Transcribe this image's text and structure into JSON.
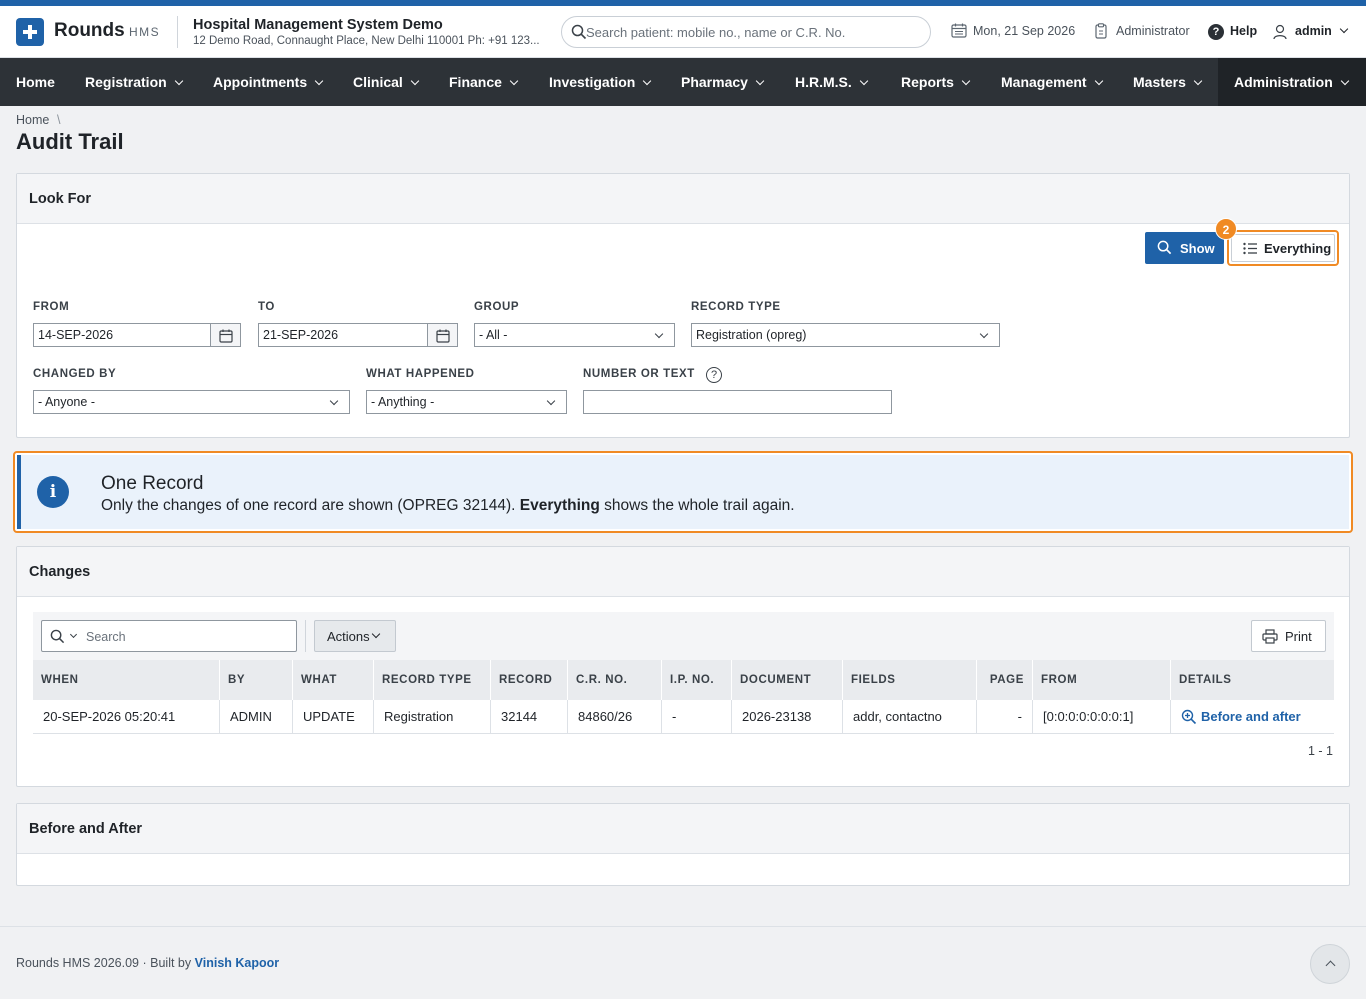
{
  "header": {
    "brand": "Rounds",
    "brand_sub": "HMS",
    "org_name": "Hospital Management System Demo",
    "org_address": "12 Demo Road, Connaught Place, New Delhi 110001 Ph: +91 123...",
    "search_placeholder": "Search patient: mobile no., name or C.R. No.",
    "date": "Mon, 21 Sep 2026",
    "role": "Administrator",
    "help": "Help",
    "user": "admin"
  },
  "nav": {
    "items": [
      {
        "label": "Home"
      },
      {
        "label": "Registration"
      },
      {
        "label": "Appointments"
      },
      {
        "label": "Clinical"
      },
      {
        "label": "Finance"
      },
      {
        "label": "Investigation"
      },
      {
        "label": "Pharmacy"
      },
      {
        "label": "H.R.M.S."
      },
      {
        "label": "Reports"
      },
      {
        "label": "Management"
      },
      {
        "label": "Masters"
      },
      {
        "label": "Administration"
      }
    ],
    "active": "Administration"
  },
  "breadcrumb": {
    "home": "Home",
    "separator": "\\"
  },
  "page": {
    "title": "Audit Trail"
  },
  "look_for": {
    "title": "Look For",
    "show_button": "Show",
    "everything_button": "Everything",
    "step_badge": "2",
    "from_label": "FROM",
    "from_value": "14-SEP-2026",
    "to_label": "TO",
    "to_value": "21-SEP-2026",
    "group_label": "GROUP",
    "group_value": "- All -",
    "record_type_label": "RECORD TYPE",
    "record_type_value": "Registration (opreg)",
    "changed_by_label": "CHANGED BY",
    "changed_by_value": "- Anyone -",
    "what_happened_label": "WHAT HAPPENED",
    "what_happened_value": "- Anything -",
    "number_text_label": "NUMBER OR TEXT",
    "number_text_value": "",
    "help_mark": "?"
  },
  "notice": {
    "icon": "i",
    "title": "One Record",
    "body_pre": "Only the changes of one record are shown (OPREG 32144). ",
    "body_bold": "Everything",
    "body_post": " shows the whole trail again."
  },
  "changes": {
    "title": "Changes",
    "search_placeholder": "Search",
    "actions_button": "Actions",
    "print_button": "Print",
    "columns": [
      "WHEN",
      "BY",
      "WHAT",
      "RECORD TYPE",
      "RECORD",
      "C.R. NO.",
      "I.P. NO.",
      "DOCUMENT",
      "FIELDS",
      "PAGE",
      "FROM",
      "DETAILS"
    ],
    "rows": [
      {
        "when": "20-SEP-2026 05:20:41",
        "by": "ADMIN",
        "what": "UPDATE",
        "record_type": "Registration",
        "record": "32144",
        "cr_no": "84860/26",
        "ip_no": "-",
        "document": "2026-23138",
        "fields": "addr, contactno",
        "page": "-",
        "from": "[0:0:0:0:0:0:0:1]",
        "details": "Before and after"
      }
    ],
    "pager": "1 - 1"
  },
  "before_after": {
    "title": "Before and After"
  },
  "footer": {
    "version": "Rounds HMS 2026.09",
    "dot": "·",
    "built_by": "Built by",
    "author": "Vinish Kapoor"
  },
  "colors": {
    "primary": "#1f62a8",
    "nav_bg": "#2d3237",
    "highlight": "#f08a24",
    "notice_bg": "#eaf2fb"
  }
}
